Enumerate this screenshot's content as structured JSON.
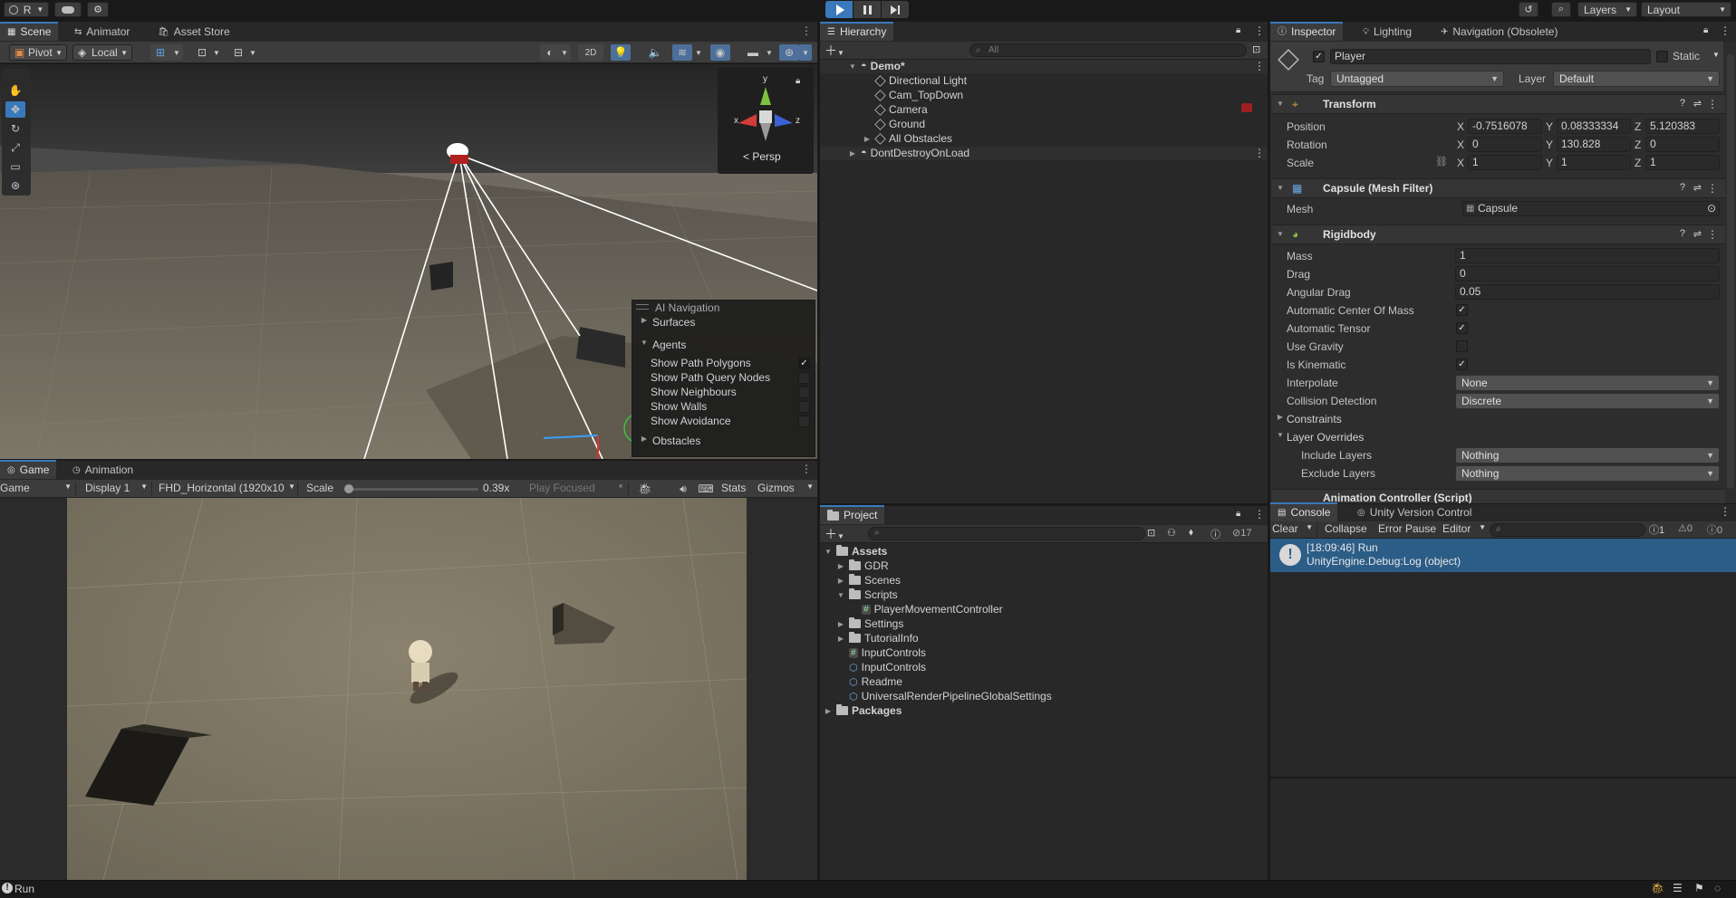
{
  "topbar": {
    "account_label": "R",
    "layers_label": "Layers",
    "layout_label": "Layout"
  },
  "scene": {
    "tabs": [
      "Scene",
      "Animator",
      "Asset Store"
    ],
    "pivot": "Pivot",
    "local": "Local",
    "mode_2d": "2D",
    "persp_label": "Persp",
    "gizmo_axes": [
      "x",
      "y",
      "z"
    ],
    "ai_nav": {
      "title": "AI Navigation",
      "surfaces": "Surfaces",
      "agents": "Agents",
      "options": [
        {
          "label": "Show Path Polygons",
          "checked": true
        },
        {
          "label": "Show Path Query Nodes",
          "checked": false
        },
        {
          "label": "Show Neighbours",
          "checked": false
        },
        {
          "label": "Show Walls",
          "checked": false
        },
        {
          "label": "Show Avoidance",
          "checked": false
        }
      ],
      "obstacles": "Obstacles"
    }
  },
  "game": {
    "tabs": [
      "Game",
      "Animation"
    ],
    "game_dropdown": "Game",
    "display": "Display 1",
    "resolution": "FHD_Horizontal (1920x10",
    "scale_label": "Scale",
    "scale_value": 0.39,
    "scale_display": "0.39x",
    "play_focused": "Play Focused",
    "stats": "Stats",
    "gizmos": "Gizmos"
  },
  "hierarchy": {
    "tab": "Hierarchy",
    "search_placeholder": "All",
    "scene_name": "Demo*",
    "items": [
      "Directional Light",
      "Cam_TopDown",
      "Camera",
      "Ground",
      "All Obstacles"
    ],
    "dont_destroy": "DontDestroyOnLoad"
  },
  "project": {
    "tab": "Project",
    "hidden_count": "17",
    "tree": [
      {
        "label": "Assets",
        "level": 0,
        "bold": true,
        "type": "folder",
        "expanded": true
      },
      {
        "label": "GDR",
        "level": 1,
        "type": "folder"
      },
      {
        "label": "Scenes",
        "level": 1,
        "type": "folder"
      },
      {
        "label": "Scripts",
        "level": 1,
        "type": "folder",
        "expanded": true
      },
      {
        "label": "PlayerMovementController",
        "level": 2,
        "type": "script"
      },
      {
        "label": "Settings",
        "level": 1,
        "type": "folder"
      },
      {
        "label": "TutorialInfo",
        "level": 1,
        "type": "folder"
      },
      {
        "label": "InputControls",
        "level": 1,
        "type": "script"
      },
      {
        "label": "InputControls",
        "level": 1,
        "type": "asset"
      },
      {
        "label": "Readme",
        "level": 1,
        "type": "asset"
      },
      {
        "label": "UniversalRenderPipelineGlobalSettings",
        "level": 1,
        "type": "asset"
      },
      {
        "label": "Packages",
        "level": 0,
        "bold": true,
        "type": "folder"
      }
    ]
  },
  "inspector": {
    "tabs": [
      "Inspector",
      "Lighting",
      "Navigation (Obsolete)"
    ],
    "object_name": "Player",
    "static_label": "Static",
    "tag_label": "Tag",
    "tag_value": "Untagged",
    "layer_label": "Layer",
    "layer_value": "Default",
    "transform": {
      "title": "Transform",
      "position_label": "Position",
      "rotation_label": "Rotation",
      "scale_label": "Scale",
      "position": [
        "-0.7516078",
        "0.08333334",
        "5.120383"
      ],
      "rotation": [
        "0",
        "130.828",
        "0"
      ],
      "scale": [
        "1",
        "1",
        "1"
      ]
    },
    "mesh_filter": {
      "title": "Capsule (Mesh Filter)",
      "mesh_label": "Mesh",
      "mesh_value": "Capsule"
    },
    "rigidbody": {
      "title": "Rigidbody",
      "mass_label": "Mass",
      "mass": "1",
      "drag_label": "Drag",
      "drag": "0",
      "angular_drag_label": "Angular Drag",
      "angular_drag": "0.05",
      "flags": [
        {
          "label": "Automatic Center Of Mass",
          "checked": true
        },
        {
          "label": "Automatic Tensor",
          "checked": true
        },
        {
          "label": "Use Gravity",
          "checked": false
        },
        {
          "label": "Is Kinematic",
          "checked": true
        }
      ],
      "interpolate_label": "Interpolate",
      "interpolate": "None",
      "collision_label": "Collision Detection",
      "collision": "Discrete",
      "constraints": "Constraints",
      "layer_overrides": "Layer Overrides",
      "include_label": "Include Layers",
      "include": "Nothing",
      "exclude_label": "Exclude Layers",
      "exclude": "Nothing"
    },
    "next_component": "Animation Controller (Script)"
  },
  "console": {
    "tabs": [
      "Console",
      "Unity Version Control"
    ],
    "clear": "Clear",
    "collapse": "Collapse",
    "error_pause": "Error Pause",
    "editor": "Editor",
    "counts": [
      "1",
      "0",
      "0"
    ],
    "entry_line1": "[18:09:46] Run",
    "entry_line2": "UnityEngine.Debug:Log (object)"
  },
  "statusbar": {
    "message": "Run"
  }
}
